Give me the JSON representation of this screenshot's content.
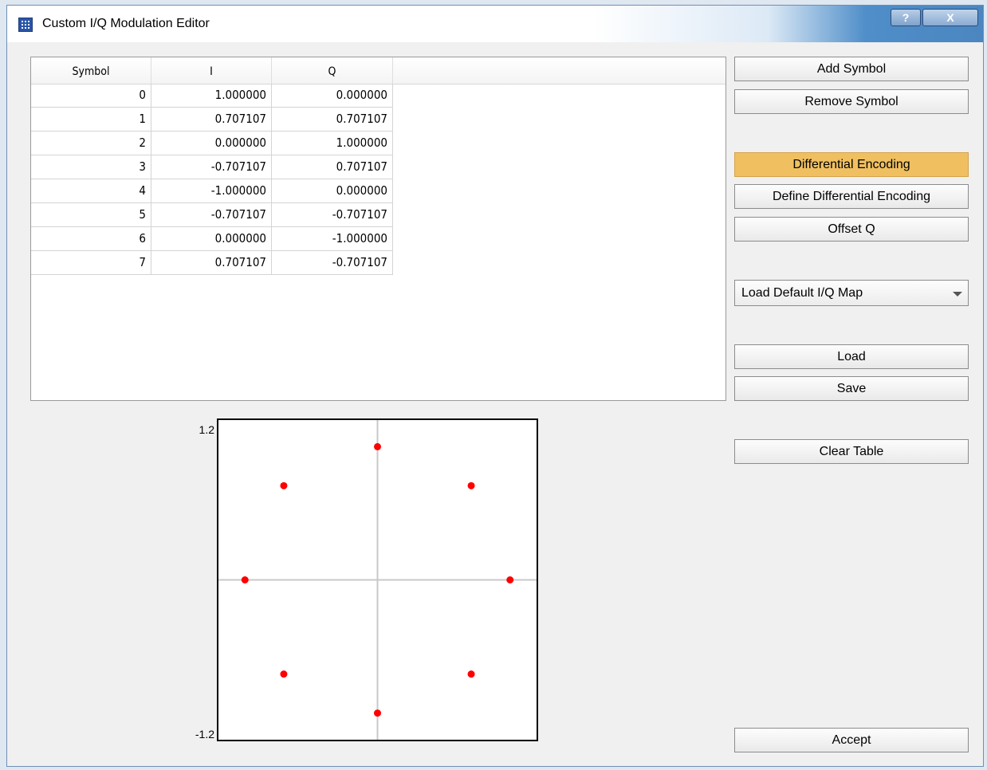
{
  "window": {
    "title": "Custom I/Q Modulation Editor",
    "help_label": "?",
    "close_label": "X"
  },
  "table": {
    "columns": [
      "Symbol",
      "I",
      "Q"
    ],
    "rows": [
      [
        "0",
        "1.000000",
        "0.000000"
      ],
      [
        "1",
        "0.707107",
        "0.707107"
      ],
      [
        "2",
        "0.000000",
        "1.000000"
      ],
      [
        "3",
        "-0.707107",
        "0.707107"
      ],
      [
        "4",
        "-1.000000",
        "0.000000"
      ],
      [
        "5",
        "-0.707107",
        "-0.707107"
      ],
      [
        "6",
        "0.000000",
        "-1.000000"
      ],
      [
        "7",
        "0.707107",
        "-0.707107"
      ]
    ]
  },
  "buttons": {
    "add_symbol": "Add Symbol",
    "remove_symbol": "Remove Symbol",
    "differential_encoding": "Differential Encoding",
    "define_differential": "Define Differential Encoding",
    "offset_q": "Offset Q",
    "load": "Load",
    "save": "Save",
    "clear_table": "Clear Table",
    "accept": "Accept"
  },
  "dropdown": {
    "selected": "Load Default I/Q Map"
  },
  "plot": {
    "y_max_label": "1.2",
    "y_min_label": "-1.2",
    "range": [
      -1.2,
      1.2
    ],
    "point_color": "#ff0000",
    "points": [
      [
        1.0,
        0.0
      ],
      [
        0.707107,
        0.707107
      ],
      [
        0.0,
        1.0
      ],
      [
        -0.707107,
        0.707107
      ],
      [
        -1.0,
        0.0
      ],
      [
        -0.707107,
        -0.707107
      ],
      [
        0.0,
        -1.0
      ],
      [
        0.707107,
        -0.707107
      ]
    ]
  },
  "colors": {
    "active_button": "#f0c060"
  }
}
